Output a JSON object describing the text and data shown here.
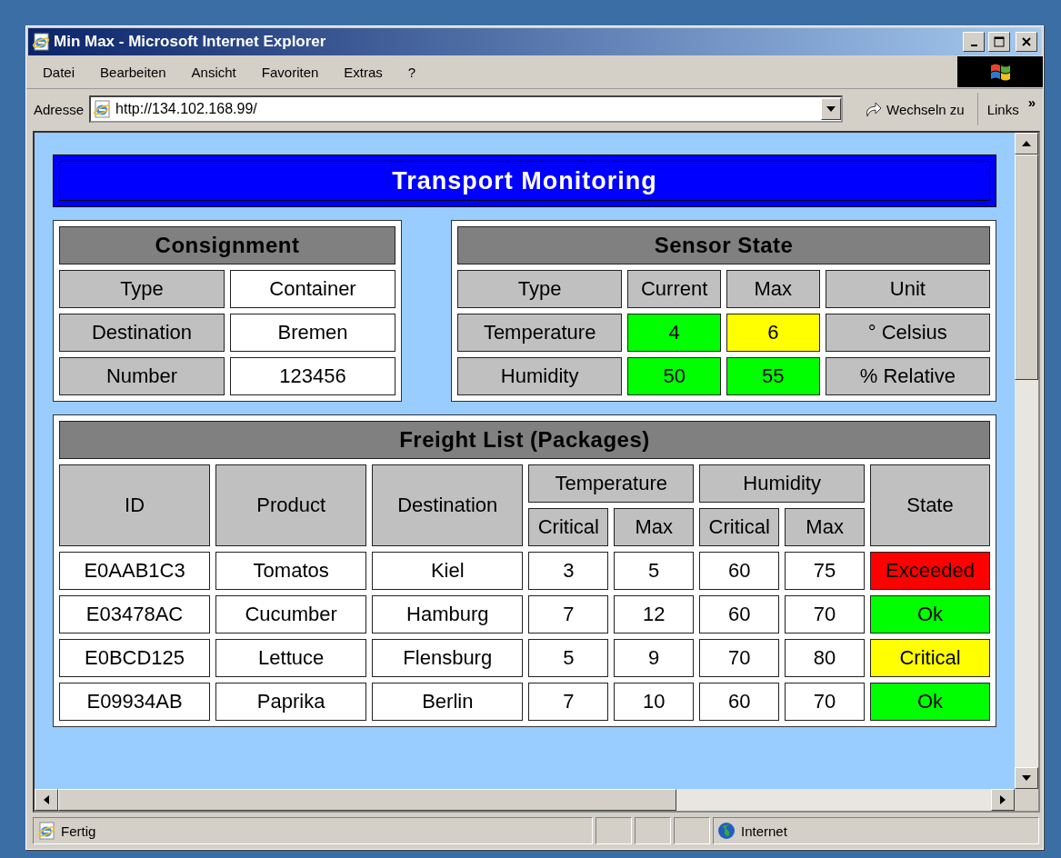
{
  "window": {
    "title": "Min Max - Microsoft Internet Explorer"
  },
  "menu": [
    "Datei",
    "Bearbeiten",
    "Ansicht",
    "Favoriten",
    "Extras",
    "?"
  ],
  "address_bar": {
    "label": "Adresse",
    "value": "http://134.102.168.99/",
    "go_button": "Wechseln zu",
    "links": "Links",
    "more": "»"
  },
  "page": {
    "title": "Transport Monitoring",
    "consignment": {
      "title": "Consignment",
      "rows": [
        {
          "label": "Type",
          "value": "Container"
        },
        {
          "label": "Destination",
          "value": "Bremen"
        },
        {
          "label": "Number",
          "value": "123456"
        }
      ]
    },
    "sensor_state": {
      "title": "Sensor State",
      "columns": [
        "Type",
        "Current",
        "Max",
        "Unit"
      ],
      "rows": [
        {
          "type": "Temperature",
          "current": {
            "text": "4",
            "color": "#00ff00"
          },
          "max": {
            "text": "6",
            "color": "#ffff00"
          },
          "unit": "° Celsius"
        },
        {
          "type": "Humidity",
          "current": {
            "text": "50",
            "color": "#00ff00"
          },
          "max": {
            "text": "55",
            "color": "#00ff00"
          },
          "unit": "% Relative"
        }
      ]
    },
    "freight_list": {
      "title": "Freight List (Packages)",
      "header_rows": [
        [
          {
            "text": "ID",
            "rowspan": 2
          },
          {
            "text": "Product",
            "rowspan": 2
          },
          {
            "text": "Destination",
            "rowspan": 2
          },
          {
            "text": "Temperature",
            "colspan": 2
          },
          {
            "text": "Humidity",
            "colspan": 2
          },
          {
            "text": "State",
            "rowspan": 2
          }
        ],
        [
          {
            "text": "Critical"
          },
          {
            "text": "Max"
          },
          {
            "text": "Critical"
          },
          {
            "text": "Max"
          }
        ]
      ],
      "rows": [
        {
          "cells": [
            "E0AAB1C3",
            "Tomatos",
            "Kiel",
            "3",
            "5",
            "60",
            "75"
          ],
          "state": {
            "text": "Exceeded",
            "color": "#ff0000"
          }
        },
        {
          "cells": [
            "E03478AC",
            "Cucumber",
            "Hamburg",
            "7",
            "12",
            "60",
            "70"
          ],
          "state": {
            "text": "Ok",
            "color": "#00ff00"
          }
        },
        {
          "cells": [
            "E0BCD125",
            "Lettuce",
            "Flensburg",
            "5",
            "9",
            "70",
            "80"
          ],
          "state": {
            "text": "Critical",
            "color": "#ffff00"
          }
        },
        {
          "cells": [
            "E09934AB",
            "Paprika",
            "Berlin",
            "7",
            "10",
            "60",
            "70"
          ],
          "state": {
            "text": "Ok",
            "color": "#00ff00"
          }
        }
      ]
    }
  },
  "status_bar": {
    "text": "Fertig",
    "zone": "Internet"
  }
}
